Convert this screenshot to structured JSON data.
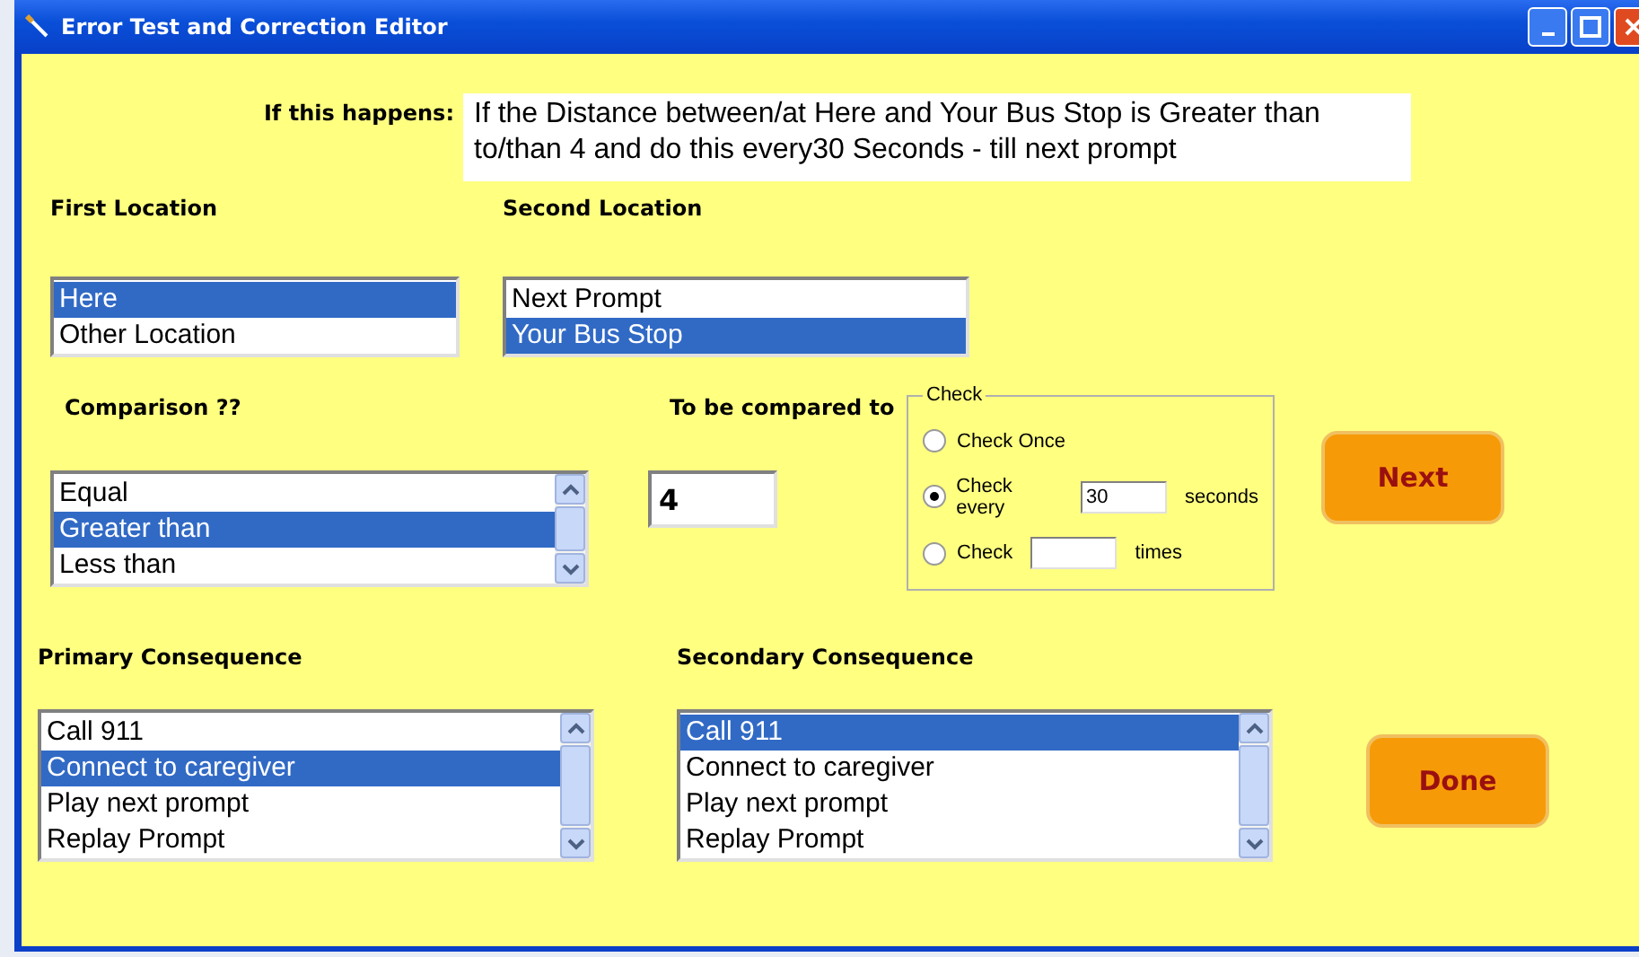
{
  "window": {
    "title": "Error Test and Correction Editor"
  },
  "condition": {
    "label": "If this happens:",
    "text": "If the Distance between/at Here and Your Bus Stop  is Greater than to/than 4 and do this every30 Seconds - till next prompt"
  },
  "first_location": {
    "label": "First Location",
    "scrollable": false,
    "items": [
      {
        "text": "Here",
        "selected": true
      },
      {
        "text": "Other Location",
        "selected": false
      }
    ]
  },
  "second_location": {
    "label": "Second Location",
    "scrollable": false,
    "items": [
      {
        "text": "Next Prompt",
        "selected": false
      },
      {
        "text": "Your Bus Stop",
        "selected": true
      }
    ]
  },
  "comparison": {
    "label": "Comparison ??",
    "scrollable": true,
    "items": [
      {
        "text": "Equal",
        "selected": false
      },
      {
        "text": "Greater than",
        "selected": true
      },
      {
        "text": "Less than",
        "selected": false
      }
    ]
  },
  "compare_value": {
    "label": "To be compared to",
    "value": "4"
  },
  "check": {
    "title": "Check",
    "options": [
      {
        "kind": "plain",
        "label": "Check Once",
        "selected": false
      },
      {
        "kind": "field",
        "label": "Check every",
        "value": "30",
        "suffix": "seconds",
        "selected": true
      },
      {
        "kind": "field",
        "label": "Check",
        "suffix": "times",
        "selected": false
      }
    ]
  },
  "next_button": "Next",
  "primary_consequence": {
    "label": "Primary Consequence",
    "scrollable": true,
    "items": [
      {
        "text": "Call 911",
        "selected": false
      },
      {
        "text": "Connect to caregiver",
        "selected": true
      },
      {
        "text": "Play next prompt",
        "selected": false
      },
      {
        "text": "Replay Prompt",
        "selected": false
      }
    ]
  },
  "secondary_consequence": {
    "label": "Secondary Consequence",
    "scrollable": true,
    "items": [
      {
        "text": "Call 911",
        "selected": true
      },
      {
        "text": "Connect to caregiver",
        "selected": false
      },
      {
        "text": "Play next prompt",
        "selected": false
      },
      {
        "text": "Replay Prompt",
        "selected": false
      }
    ]
  },
  "done_button": "Done"
}
